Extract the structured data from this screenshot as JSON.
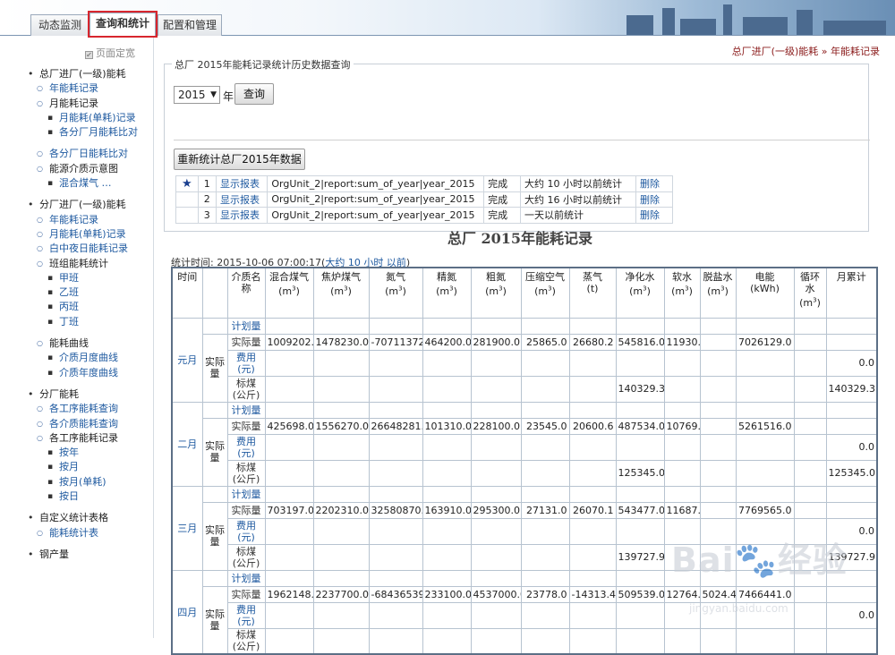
{
  "tabs": [
    {
      "label": "动态监测"
    },
    {
      "label": "查询和统计"
    },
    {
      "label": "配置和管理"
    }
  ],
  "sidebar": {
    "fix_label": "页面定宽",
    "items": [
      {
        "level": 0,
        "label": "总厂进厂(一级)能耗"
      },
      {
        "level": 1,
        "label": "年能耗记录",
        "link": true
      },
      {
        "level": 1,
        "label": "月能耗记录",
        "link": false
      },
      {
        "level": 2,
        "label": "月能耗(单耗)记录",
        "link": true
      },
      {
        "level": 2,
        "label": "各分厂月能耗比对",
        "link": true
      },
      {
        "gap": true
      },
      {
        "level": 1,
        "label": "各分厂日能耗比对",
        "link": true
      },
      {
        "level": 1,
        "label": "能源介质示意图",
        "link": false
      },
      {
        "level": 2,
        "label": "混合煤气 …",
        "link": true
      },
      {
        "gap": true
      },
      {
        "level": 0,
        "label": "分厂进厂(一级)能耗"
      },
      {
        "level": 1,
        "label": "年能耗记录",
        "link": true
      },
      {
        "level": 1,
        "label": "月能耗(单耗)记录",
        "link": true
      },
      {
        "level": 1,
        "label": "白中夜日能耗记录",
        "link": true
      },
      {
        "level": 1,
        "label": "班组能耗统计",
        "link": false
      },
      {
        "level": 2,
        "label": "甲班",
        "link": true
      },
      {
        "level": 2,
        "label": "乙班",
        "link": true
      },
      {
        "level": 2,
        "label": "丙班",
        "link": true
      },
      {
        "level": 2,
        "label": "丁班",
        "link": true
      },
      {
        "gap": true
      },
      {
        "level": 1,
        "label": "能耗曲线",
        "link": false
      },
      {
        "level": 2,
        "label": "介质月度曲线",
        "link": true
      },
      {
        "level": 2,
        "label": "介质年度曲线",
        "link": true
      },
      {
        "gap": true
      },
      {
        "level": 0,
        "label": "分厂能耗"
      },
      {
        "level": 1,
        "label": "各工序能耗查询",
        "link": true
      },
      {
        "level": 1,
        "label": "各介质能耗查询",
        "link": true
      },
      {
        "level": 1,
        "label": "各工序能耗记录",
        "link": false
      },
      {
        "level": 2,
        "label": "按年",
        "link": true
      },
      {
        "level": 2,
        "label": "按月",
        "link": true
      },
      {
        "level": 2,
        "label": "按月(单耗)",
        "link": true
      },
      {
        "level": 2,
        "label": "按日",
        "link": true
      },
      {
        "gap": true
      },
      {
        "level": 0,
        "label": "自定义统计表格"
      },
      {
        "level": 1,
        "label": "能耗统计表",
        "link": true
      },
      {
        "gap": true
      },
      {
        "level": 0,
        "label": "钢产量"
      }
    ]
  },
  "breadcrumb": "总厂进厂(一级)能耗 » 年能耗记录",
  "query": {
    "legend": "总厂 2015年能耗记录统计历史数据查询",
    "year": "2015",
    "year_suffix": "年",
    "query_btn": "查询",
    "recalc_btn": "重新统计总厂2015年数据"
  },
  "history": [
    {
      "star": "★",
      "no": "1",
      "show": "显示报表",
      "key": "OrgUnit_2|report:sum_of_year|year_2015",
      "status": "完成",
      "time": "大约 10 小时以前统计",
      "del": "删除"
    },
    {
      "star": "",
      "no": "2",
      "show": "显示报表",
      "key": "OrgUnit_2|report:sum_of_year|year_2015",
      "status": "完成",
      "time": "大约 16 小时以前统计",
      "del": "删除"
    },
    {
      "star": "",
      "no": "3",
      "show": "显示报表",
      "key": "OrgUnit_2|report:sum_of_year|year_2015",
      "status": "完成",
      "time": "一天以前统计",
      "del": "删除"
    }
  ],
  "report": {
    "title": "总厂 2015年能耗记录",
    "stat_prefix": "统计时间: 2015-10-06 07:00:17(",
    "stat_link": "大约 10 小时 以前",
    "stat_suffix": ")",
    "headers": {
      "time": "时间",
      "medium": "介质名称",
      "cols": [
        {
          "name": "混合煤气",
          "unit": "(m3)"
        },
        {
          "name": "焦炉煤气",
          "unit": "(m3)"
        },
        {
          "name": "氮气",
          "unit": "(m3)"
        },
        {
          "name": "精氮",
          "unit": "(m3)"
        },
        {
          "name": "粗氮",
          "unit": "(m3)"
        },
        {
          "name": "压缩空气",
          "unit": "(m3)"
        },
        {
          "name": "蒸气",
          "unit": "(t)"
        },
        {
          "name": "净化水",
          "unit": "(m3)"
        },
        {
          "name": "软水",
          "unit": "(m3)"
        },
        {
          "name": "脱盐水",
          "unit": "(m3)"
        },
        {
          "name": "电能",
          "unit": "(kWh)"
        },
        {
          "name": "循环水",
          "unit": "(m3)"
        }
      ],
      "total": "月累计"
    },
    "row_labels": {
      "plan": "计划量",
      "actual_group": "实际量",
      "actual": "实际量",
      "cost": "费用(元)",
      "coal": "标煤(公斤)"
    },
    "months": [
      {
        "name": "元月",
        "actual": [
          "1009202.0",
          "1478230.0",
          "-70711372.0",
          "464200.0",
          "281900.0",
          "25865.0",
          "26680.2",
          "545816.0",
          "11930.0",
          "",
          "7026129.0",
          ""
        ],
        "cost_total": "0.0",
        "coal": [
          "",
          "",
          "",
          "",
          "",
          "",
          "",
          "140329.3",
          "",
          "",
          "",
          ""
        ],
        "coal_total": "140329.3"
      },
      {
        "name": "二月",
        "actual": [
          "425698.0",
          "1556270.0",
          "26648281.0",
          "101310.0",
          "228100.0",
          "23545.0",
          "20600.6",
          "487534.0",
          "10769.0",
          "",
          "5261516.0",
          ""
        ],
        "cost_total": "0.0",
        "coal": [
          "",
          "",
          "",
          "",
          "",
          "",
          "",
          "125345.0",
          "",
          "",
          "",
          ""
        ],
        "coal_total": "125345.0"
      },
      {
        "name": "三月",
        "actual": [
          "703197.0",
          "2202310.0",
          "32580870.0",
          "163910.0",
          "295300.0",
          "27131.0",
          "26070.1",
          "543477.0",
          "11687.0",
          "",
          "7769565.0",
          ""
        ],
        "cost_total": "0.0",
        "coal": [
          "",
          "",
          "",
          "",
          "",
          "",
          "",
          "139727.9",
          "",
          "",
          "",
          ""
        ],
        "coal_total": "139727.9"
      },
      {
        "name": "四月",
        "actual": [
          "1962148.0",
          "2237700.0",
          "-68436539.0",
          "233100.0",
          "4537000.0",
          "23778.0",
          "-14313.4",
          "509539.0",
          "12764.8",
          "5024.4",
          "7466441.0",
          ""
        ],
        "cost_total": "0.0",
        "coal": [
          "",
          "",
          "",
          "",
          "",
          "",
          "",
          "",
          "",
          "",
          "",
          ""
        ],
        "coal_total": ""
      }
    ]
  },
  "watermark": {
    "brand": "Bai",
    "brand2": "经验",
    "url": "jingyan.baidu.com"
  }
}
